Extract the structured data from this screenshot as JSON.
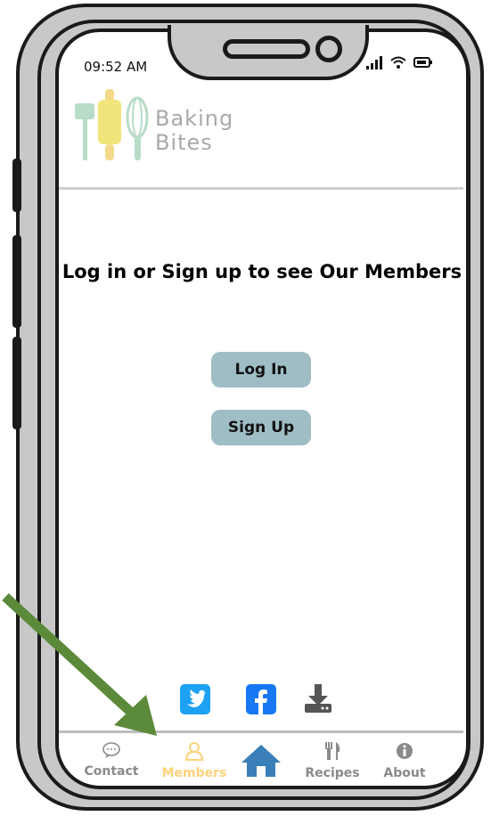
{
  "status_bar": {
    "time": "09:52 AM"
  },
  "app": {
    "logo_line1": "Baking",
    "logo_line2": "Bites"
  },
  "content": {
    "heading": "Log in or Sign up to see Our Members",
    "login_label": "Log In",
    "signup_label": "Sign Up"
  },
  "social": [
    {
      "name": "twitter",
      "color": "#1da1f2"
    },
    {
      "name": "facebook",
      "color": "#1877f2"
    },
    {
      "name": "download",
      "color": "#555555"
    }
  ],
  "nav": {
    "contact": "Contact",
    "members": "Members",
    "recipes": "Recipes",
    "about": "About",
    "active": "members"
  },
  "colors": {
    "button_bg": "#9fbdc4",
    "active_nav": "#ffd27a",
    "home_icon": "#3b7fb8",
    "annotation_arrow": "#5b8a3a"
  }
}
